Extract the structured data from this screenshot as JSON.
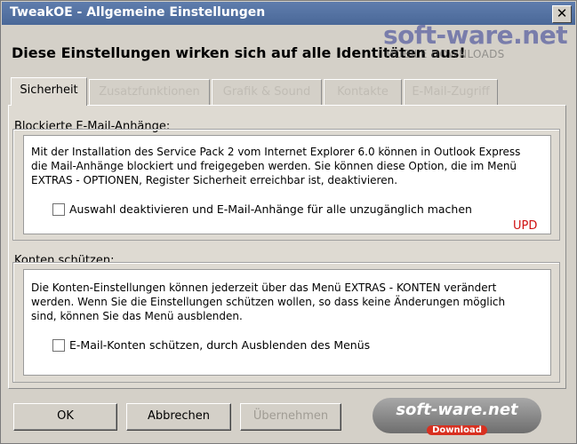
{
  "window": {
    "title": "TweakOE - Allgemeine Einstellungen",
    "close_glyph": "✕"
  },
  "headline": "Diese Einstellungen wirken sich auf alle Identitäten aus!",
  "watermark": {
    "logo": "soft-ware.net",
    "subtitle": "MOBILE DOWNLOADS"
  },
  "tabs": [
    {
      "label": "Sicherheit",
      "active": true
    },
    {
      "label": "Zusatzfunktionen",
      "active": false
    },
    {
      "label": "Grafik & Sound",
      "active": false
    },
    {
      "label": "Kontakte",
      "active": false
    },
    {
      "label": "E-Mail-Zugriff",
      "active": false
    }
  ],
  "groups": [
    {
      "label": "Blockierte E-Mail-Anhänge:",
      "description_lines": [
        "Mit der Installation des Service Pack 2 vom Internet Explorer 6.0 können in Outlook Express",
        "die Mail-Anhänge blockiert und freigegeben werden. Sie können diese Option, die im Menü",
        "EXTRAS - OPTIONEN, Register Sicherheit erreichbar ist, deaktivieren."
      ],
      "checkbox_label": "Auswahl deaktivieren und E-Mail-Anhänge für alle unzugänglich machen",
      "checked": false,
      "badge": "UPD"
    },
    {
      "label": "Konten schützen:",
      "description_lines": [
        "Die Konten-Einstellungen können jederzeit über das Menü EXTRAS - KONTEN verändert",
        "werden. Wenn Sie die Einstellungen schützen wollen, so dass keine Änderungen möglich",
        "sind, können Sie das Menü ausblenden."
      ],
      "checkbox_label": "E-Mail-Konten schützen, durch Ausblenden des Menüs",
      "checked": false
    }
  ],
  "buttons": {
    "ok": "OK",
    "cancel": "Abbrechen",
    "apply": "Übernehmen"
  },
  "logo_badge": {
    "main": "soft-ware.net",
    "sub": "Download"
  },
  "colors": {
    "titlebar": "#4a6898",
    "dialog_bg": "#d4d0c8",
    "badge_red": "#d01010"
  }
}
